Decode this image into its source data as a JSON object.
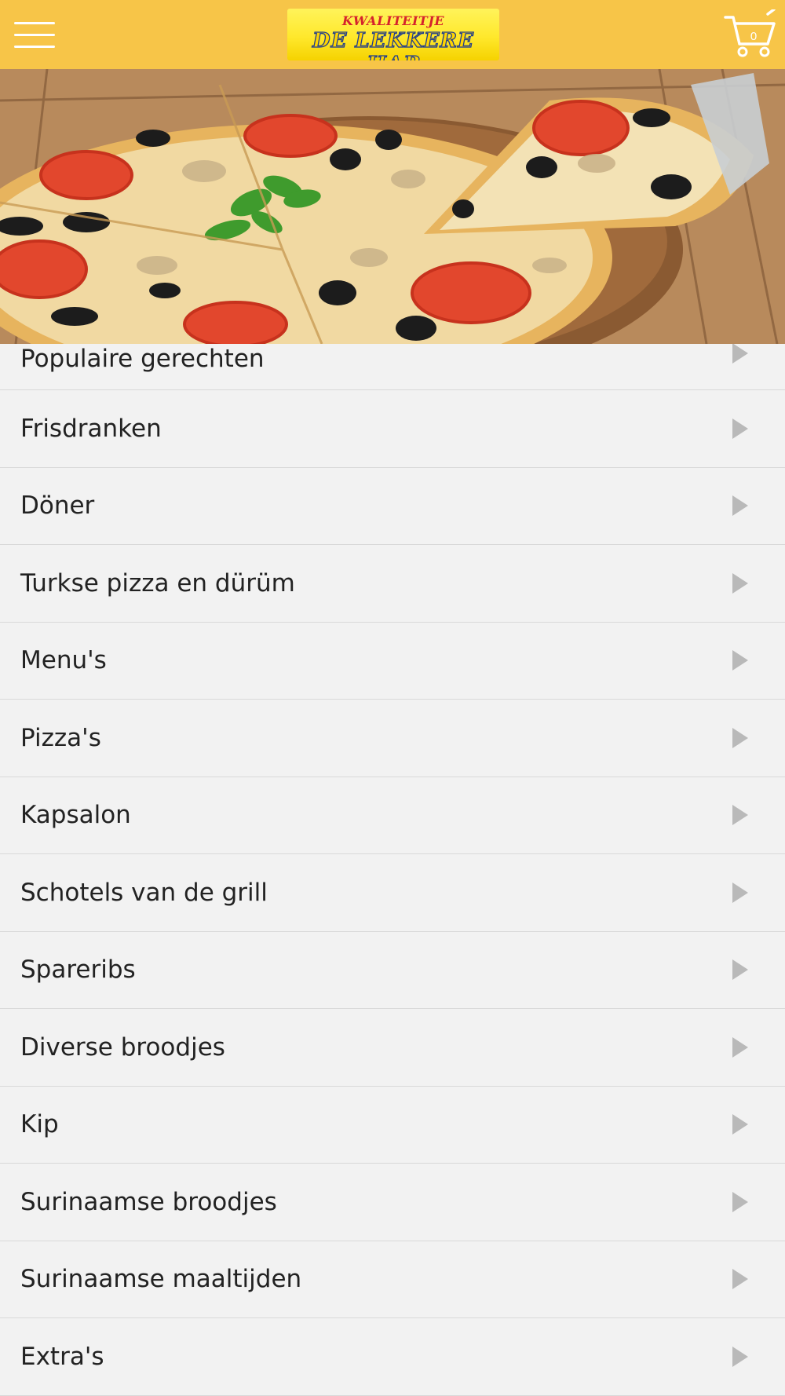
{
  "header": {
    "logo_top": "KWALITEITJE",
    "logo_bottom": "DE LEKKERE HAP",
    "cart_count": "0"
  },
  "hero": {
    "image": "pizza-photo"
  },
  "categories": [
    {
      "label": "Populaire gerechten"
    },
    {
      "label": "Frisdranken"
    },
    {
      "label": "Döner"
    },
    {
      "label": "Turkse pizza en dürüm"
    },
    {
      "label": "Menu's"
    },
    {
      "label": "Pizza's"
    },
    {
      "label": "Kapsalon"
    },
    {
      "label": "Schotels van de grill"
    },
    {
      "label": "Spareribs"
    },
    {
      "label": "Diverse broodjes"
    },
    {
      "label": "Kip"
    },
    {
      "label": "Surinaamse broodjes"
    },
    {
      "label": "Surinaamse maaltijden"
    },
    {
      "label": "Extra's"
    }
  ],
  "colors": {
    "header_bg": "#f7c548",
    "list_bg": "#f2f2f2",
    "arrow": "#b9b9b9"
  }
}
